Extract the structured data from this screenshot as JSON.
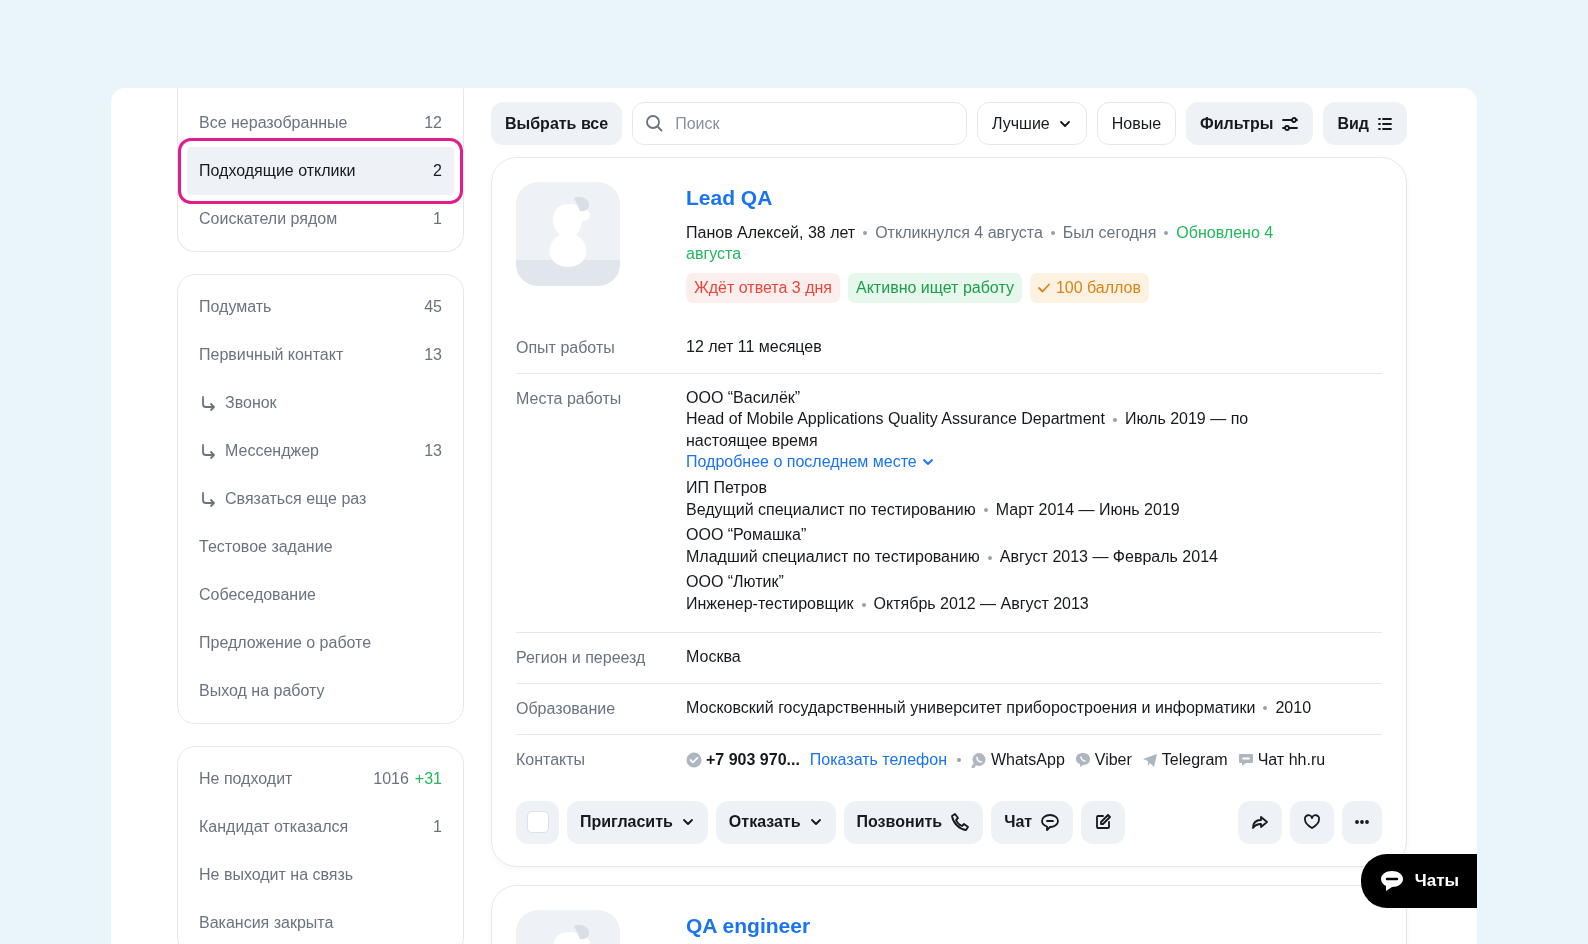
{
  "sidebar": {
    "groups": [
      {
        "items": [
          {
            "label": "Все неразобранные",
            "count": "12",
            "selected": false
          },
          {
            "label": "Подходящие отклики",
            "count": "2",
            "selected": true
          },
          {
            "label": "Соискатели рядом",
            "count": "1",
            "selected": false
          }
        ]
      },
      {
        "items": [
          {
            "label": "Подумать",
            "count": "45",
            "selected": false
          },
          {
            "label": "Первичный контакт",
            "count": "13",
            "selected": false,
            "children": [
              {
                "label": "Звонок",
                "selected": false
              },
              {
                "label": "Мессенджер",
                "count": "13",
                "selected": false
              },
              {
                "label": "Связаться еще раз",
                "selected": false
              }
            ]
          },
          {
            "label": "Тестовое задание",
            "selected": false
          },
          {
            "label": "Собеседование",
            "selected": false
          },
          {
            "label": "Предложение о работе",
            "selected": false
          },
          {
            "label": "Выход на работу",
            "selected": false
          }
        ]
      },
      {
        "items": [
          {
            "label": "Не подходит",
            "count": "1016",
            "new": "+31",
            "selected": false
          },
          {
            "label": "Кандидат отказался",
            "count": "1",
            "selected": false
          },
          {
            "label": "Не выходит на связь",
            "selected": false
          },
          {
            "label": "Вакансия закрыта",
            "selected": false
          }
        ]
      }
    ]
  },
  "toolbar": {
    "select_all": "Выбрать все",
    "search": {
      "placeholder": "Поиск"
    },
    "buttons": [
      {
        "kind": "dropdown",
        "label": "Лучшие"
      },
      {
        "kind": "outline",
        "label": "Новые"
      },
      {
        "kind": "filters",
        "label": "Фильтры"
      },
      {
        "kind": "view",
        "label": "Вид"
      }
    ]
  },
  "cards": [
    {
      "title": "Lead QA",
      "meta": [
        {
          "text": "Панов Алексей, 38 лет",
          "kind": "name"
        },
        {
          "text": "Откликнулся 4 августа",
          "kind": "muted"
        },
        {
          "text": "Был сегодня",
          "kind": "muted"
        },
        {
          "text": "Обновлено 4 августа",
          "kind": "success"
        }
      ],
      "tags": [
        {
          "text": "Ждёт ответа 3 дня",
          "color": "#fdeeee",
          "check": false
        },
        {
          "text": "Активно ищет работу",
          "color": "#e6f7ec",
          "check": false
        },
        {
          "text": "100 баллов",
          "color": "#fdf1e2",
          "check": true
        }
      ],
      "experience": {
        "label": "Опыт работы",
        "value": "12 лет 11 месяцев"
      },
      "workplaces": {
        "label": "Места работы",
        "items": [
          {
            "company": "ООО “Василёк”",
            "position": "Head of Mobile Applications Quality Assurance Department",
            "period": "Июль 2019 — по настоящее время",
            "more": "Подробнее о последнем месте"
          },
          {
            "company": "ИП Петров",
            "position": "Ведущий специалист по тестированию",
            "period": "Март 2014 — Июнь 2019"
          },
          {
            "company": "ООО “Ромашка”",
            "position": "Младший специалист по тестированию",
            "period": "Август 2013 — Февраль 2014"
          },
          {
            "company": "ООО “Лютик”",
            "position": "Инженер-тестировщик",
            "period": "Октябрь 2012 — Август 2013"
          }
        ]
      },
      "region": {
        "label": "Регион и переезд",
        "value": "Москва"
      },
      "education": {
        "label": "Образование",
        "value": "Московский государственный университет приборостроения и информатики",
        "year": "2010"
      },
      "contacts": {
        "label": "Контакты",
        "items": [
          {
            "kind": "phone",
            "text": "+7 903 970..."
          },
          {
            "kind": "link",
            "text": "Показать телефон"
          },
          {
            "kind": "whatsapp",
            "text": "WhatsApp"
          },
          {
            "kind": "viber",
            "text": "Viber"
          },
          {
            "kind": "telegram",
            "text": "Telegram"
          },
          {
            "kind": "chat",
            "text": "Чат hh.ru"
          }
        ]
      },
      "select": {
        "checked": false
      },
      "actions": [
        {
          "kind": "dropdown",
          "label": "Пригласить"
        },
        {
          "kind": "dropdown",
          "label": "Отказать"
        },
        {
          "kind": "phone",
          "label": "Позвонить"
        },
        {
          "kind": "chat",
          "label": "Чат"
        }
      ]
    },
    {
      "title": "QA engineer"
    }
  ],
  "chats_button": "Чаты"
}
